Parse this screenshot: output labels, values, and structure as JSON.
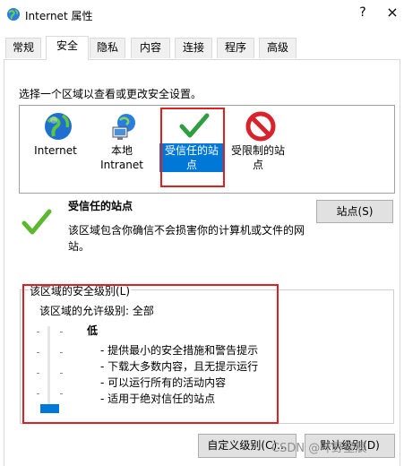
{
  "window": {
    "title": "Internet 属性",
    "help_label": "?",
    "close_label": "×"
  },
  "tabs": [
    {
      "label": "常规"
    },
    {
      "label": "安全"
    },
    {
      "label": "隐私"
    },
    {
      "label": "内容"
    },
    {
      "label": "连接"
    },
    {
      "label": "程序"
    },
    {
      "label": "高级"
    }
  ],
  "active_tab": "安全",
  "security": {
    "select_prompt": "选择一个区域以查看或更改安全设置。",
    "zones": [
      {
        "label": "Internet",
        "icon": "globe-icon"
      },
      {
        "label": "本地\nIntranet",
        "icon": "local-intranet-icon"
      },
      {
        "label": "受信任的站\n点",
        "icon": "checkmark-icon"
      },
      {
        "label": "受限制的站\n点",
        "icon": "restricted-icon"
      }
    ],
    "selected_zone": "受信任的站点",
    "zone_heading": "受信任的站点",
    "zone_description": "该区域包含你确信不会损害你的计算机或文件的网站。",
    "sites_button": "站点(S)",
    "level_group_label": "该区域的安全级别(L)",
    "allowed_levels": "该区域的允许级别: 全部",
    "slider_level": 0,
    "level_name": "低",
    "level_bullets": [
      "- 提供最小的安全措施和警告提示",
      "- 下载大多数内容，且无提示运行",
      "- 可以运行所有的活动内容",
      "- 适用于绝对信任的站点"
    ],
    "custom_level_button": "自定义级别(C)...",
    "default_level_button": "默认级别(D)"
  },
  "colors": {
    "selection_blue": "#0078d7",
    "highlight_red": "#e02020",
    "check_green": "#2e9e3f"
  },
  "watermark": "CSDN @叶野星辰"
}
